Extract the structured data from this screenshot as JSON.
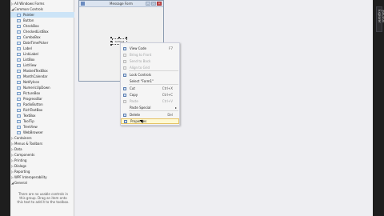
{
  "toolbox": {
    "items": [
      {
        "label": "All Windows Forms",
        "kind": "category",
        "expanded": false
      },
      {
        "label": "Common Controls",
        "kind": "category",
        "expanded": true
      },
      {
        "label": "Pointer",
        "kind": "item",
        "selected": true
      },
      {
        "label": "Button",
        "kind": "item"
      },
      {
        "label": "CheckBox",
        "kind": "item"
      },
      {
        "label": "CheckedListBox",
        "kind": "item"
      },
      {
        "label": "ComboBox",
        "kind": "item"
      },
      {
        "label": "DateTimePicker",
        "kind": "item"
      },
      {
        "label": "Label",
        "kind": "item"
      },
      {
        "label": "LinkLabel",
        "kind": "item"
      },
      {
        "label": "ListBox",
        "kind": "item"
      },
      {
        "label": "ListView",
        "kind": "item"
      },
      {
        "label": "MaskedTextBox",
        "kind": "item"
      },
      {
        "label": "MonthCalendar",
        "kind": "item"
      },
      {
        "label": "NotifyIcon",
        "kind": "item"
      },
      {
        "label": "NumericUpDown",
        "kind": "item"
      },
      {
        "label": "PictureBox",
        "kind": "item"
      },
      {
        "label": "ProgressBar",
        "kind": "item"
      },
      {
        "label": "RadioButton",
        "kind": "item"
      },
      {
        "label": "RichTextBox",
        "kind": "item"
      },
      {
        "label": "TextBox",
        "kind": "item"
      },
      {
        "label": "ToolTip",
        "kind": "item"
      },
      {
        "label": "TreeView",
        "kind": "item"
      },
      {
        "label": "WebBrowser",
        "kind": "item"
      },
      {
        "label": "Containers",
        "kind": "category",
        "expanded": false
      },
      {
        "label": "Menus & Toolbars",
        "kind": "category",
        "expanded": false
      },
      {
        "label": "Data",
        "kind": "category",
        "expanded": false
      },
      {
        "label": "Components",
        "kind": "category",
        "expanded": false
      },
      {
        "label": "Printing",
        "kind": "category",
        "expanded": false
      },
      {
        "label": "Dialogs",
        "kind": "category",
        "expanded": false
      },
      {
        "label": "Reporting",
        "kind": "category",
        "expanded": false
      },
      {
        "label": "WPF Interoperability",
        "kind": "category",
        "expanded": false
      },
      {
        "label": "General",
        "kind": "category",
        "expanded": true
      }
    ],
    "empty_message": "There are no usable controls in this group. Drag an item onto this text to add it to the toolbox."
  },
  "form": {
    "title": "Message Form",
    "button_label": "button1"
  },
  "context_menu": {
    "items": [
      {
        "label": "View Code",
        "shortcut": "F7",
        "disabled": false,
        "icon": "code-icon"
      },
      {
        "label": "Bring to Front",
        "shortcut": "",
        "disabled": true,
        "icon": "bring-front-icon"
      },
      {
        "label": "Send to Back",
        "shortcut": "",
        "disabled": true,
        "icon": "send-back-icon"
      },
      {
        "label": "Align to Grid",
        "shortcut": "",
        "disabled": true,
        "icon": "grid-icon"
      },
      {
        "label": "Lock Controls",
        "shortcut": "",
        "disabled": false,
        "icon": "lock-icon"
      },
      {
        "label": "Select \"Form1\"",
        "shortcut": "",
        "disabled": false,
        "icon": ""
      },
      {
        "label": "Cut",
        "shortcut": "Ctrl+X",
        "disabled": false,
        "icon": "cut-icon"
      },
      {
        "label": "Copy",
        "shortcut": "Ctrl+C",
        "disabled": false,
        "icon": "copy-icon"
      },
      {
        "label": "Paste",
        "shortcut": "Ctrl+V",
        "disabled": true,
        "icon": "paste-icon"
      },
      {
        "label": "Paste Special",
        "shortcut": "",
        "disabled": false,
        "icon": "",
        "submenu": true
      },
      {
        "label": "Delete",
        "shortcut": "Del",
        "disabled": false,
        "icon": "delete-icon"
      },
      {
        "label": "Properties",
        "shortcut": "",
        "disabled": false,
        "icon": "wrench-icon",
        "hovered": true
      }
    ]
  },
  "right_panel": {
    "tab_label": "Solution Explorer"
  }
}
